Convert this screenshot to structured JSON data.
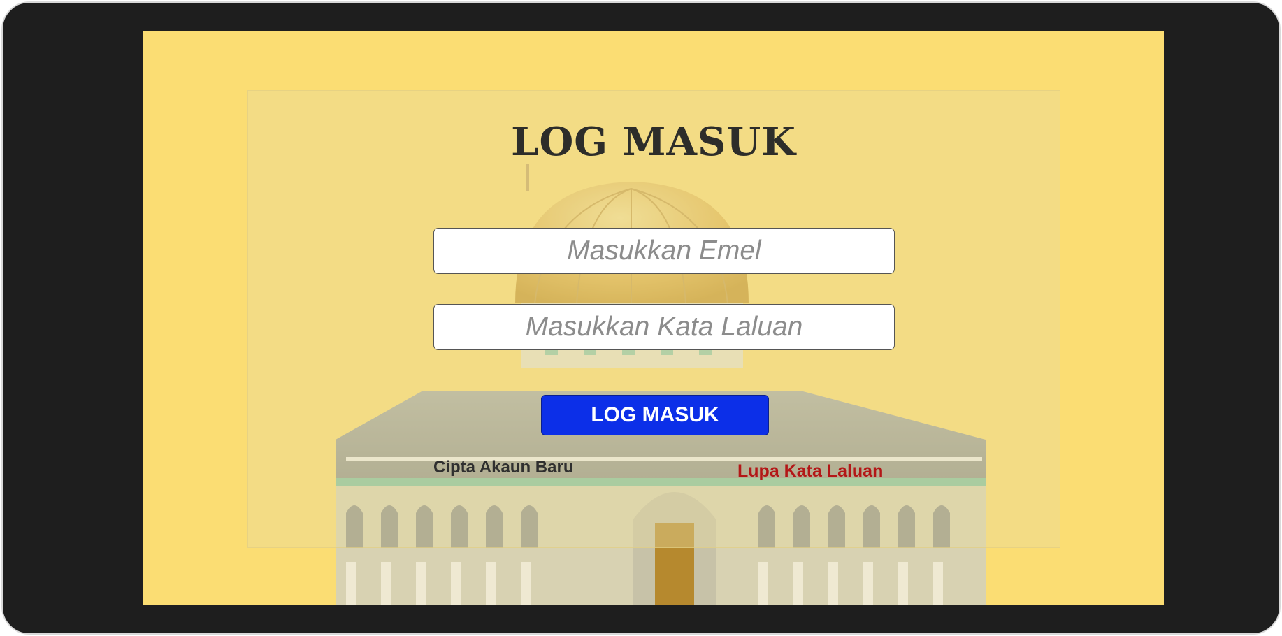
{
  "login": {
    "title": "LOG MASUK",
    "email_placeholder": "Masukkan Emel",
    "password_placeholder": "Masukkan Kata Laluan",
    "submit_label": "LOG MASUK",
    "create_account_label": "Cipta Akaun Baru",
    "forgot_password_label": "Lupa Kata Laluan"
  },
  "theme": {
    "background": "#fbdd73",
    "button": "#0c2fe8",
    "forgot_link": "#b31717",
    "frame": "#1e1e1e"
  },
  "illustration": "mosque-dome-illustration"
}
